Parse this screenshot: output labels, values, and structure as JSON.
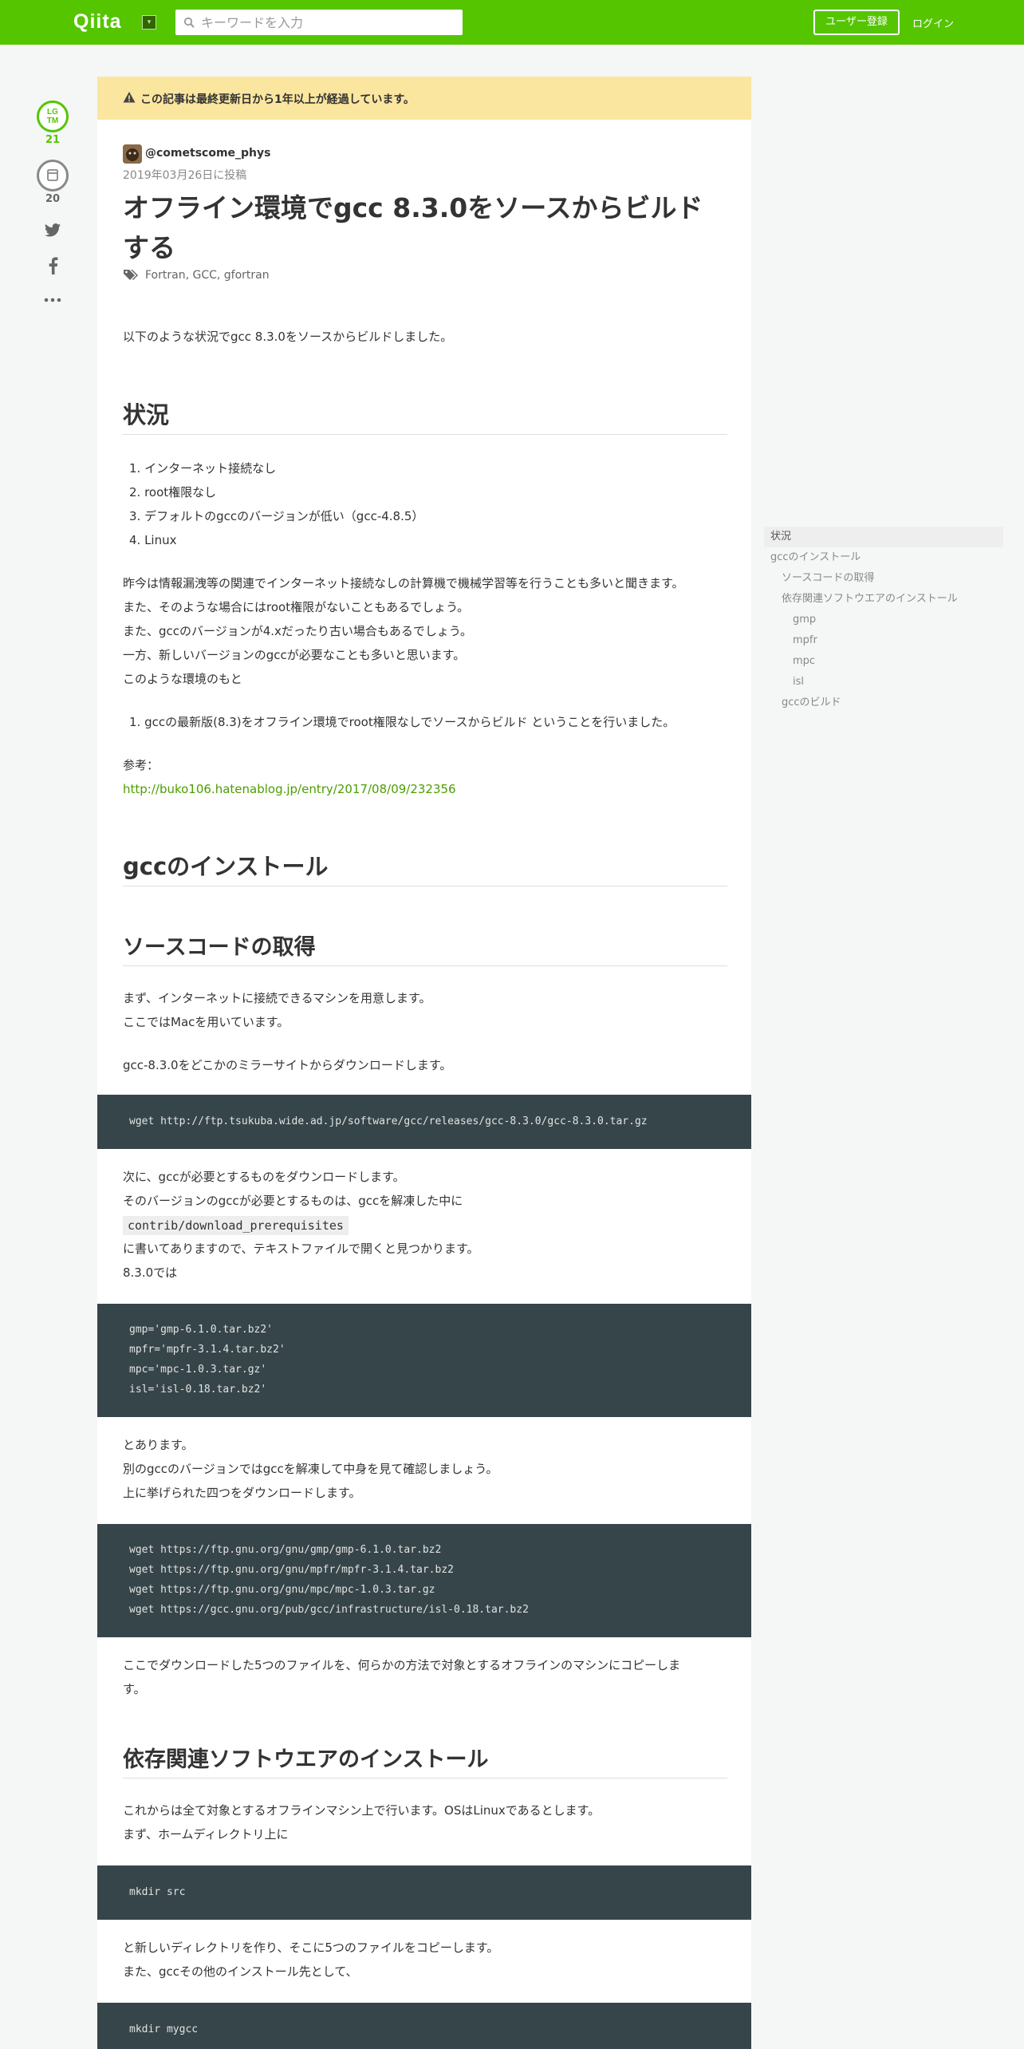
{
  "header": {
    "logo": "Qiita",
    "logo_dropdown": "▾",
    "search_placeholder": "キーワードを入力",
    "signup_label": "ユーザー登録",
    "login_label": "ログイン"
  },
  "side": {
    "lgtm_line1": "LG",
    "lgtm_line2": "TM",
    "lgtm_count": "21",
    "stock_count": "20"
  },
  "article": {
    "notice": "この記事は最終更新日から1年以上が経過しています。",
    "author": "@cometscome_phys",
    "date": "2019年03月26日に投稿",
    "title": "オフライン環境でgcc 8.3.0をソースからビルドする",
    "tags": "Fortran,  GCC,  gfortran",
    "intro": "以下のような状況でgcc 8.3.0をソースからビルドしました。",
    "h_situation": "状況",
    "situation_items": [
      "1. インターネット接続なし",
      "2. root権限なし",
      "3. デフォルトのgccのバージョンが低い（gcc-4.8.5）",
      "4. Linux"
    ],
    "situation_paras": [
      "昨今は情報漏洩等の関連でインターネット接続なしの計算機で機械学習等を行うことも多いと聞きます。",
      "また、そのような場合にはroot権限がないこともあるでしょう。",
      "また、gccのバージョンが4.xだったり古い場合もあるでしょう。",
      "一方、新しいバージョンのgccが必要なことも多いと思います。",
      "このような環境のもと"
    ],
    "goal_item": "1. gccの最新版(8.3)をオフライン環境でroot権限なしでソースからビルド ということを行いました。",
    "ref_label": "参考：",
    "ref_link": "http://buko106.hatenablog.jp/entry/2017/08/09/232356",
    "h_install": "gccのインストール",
    "h_source": "ソースコードの取得",
    "source_paras": [
      "まず、インターネットに接続できるマシンを用意します。",
      "ここではMacを用いています。"
    ],
    "download_para": "gcc-8.3.0をどこかのミラーサイトからダウンロードします。",
    "code1": [
      "wget http://ftp.tsukuba.wide.ad.jp/software/gcc/releases/gcc-8.3.0/gcc-8.3.0.tar.gz"
    ],
    "prereq_paras": [
      "次に、gccが必要とするものをダウンロードします。",
      "そのバージョンのgccが必要とするものは、gccを解凍した中に"
    ],
    "prereq_code": "contrib/download_prerequisites",
    "prereq_paras2": [
      "に書いてありますので、テキストファイルで開くと見つかります。",
      "8.3.0では"
    ],
    "code2": [
      "gmp='gmp-6.1.0.tar.bz2'",
      "mpfr='mpfr-3.1.4.tar.bz2'",
      "mpc='mpc-1.0.3.tar.gz'",
      "isl='isl-0.18.tar.bz2'"
    ],
    "after_code2": [
      "とあります。",
      "別のgccのバージョンではgccを解凍して中身を見て確認しましょう。",
      "上に挙げられた四つをダウンロードします。"
    ],
    "code3": [
      "wget https://ftp.gnu.org/gnu/gmp/gmp-6.1.0.tar.bz2",
      "wget https://ftp.gnu.org/gnu/mpfr/mpfr-3.1.4.tar.bz2",
      "wget https://ftp.gnu.org/gnu/mpc/mpc-1.0.3.tar.gz",
      "wget https://gcc.gnu.org/pub/gcc/infrastructure/isl-0.18.tar.bz2"
    ],
    "copy_para": [
      "ここでダウンロードした5つのファイルを、何らかの方法で対象とするオフラインのマシンにコピーしま",
      "す。"
    ],
    "h_deps": "依存関連ソフトウエアのインストール",
    "deps_paras": [
      "これからは全て対象とするオフラインマシン上で行います。OSはLinuxであるとします。",
      "まず、ホームディレクトリ上に"
    ],
    "code4": [
      "mkdir src"
    ],
    "after_code4": [
      "と新しいディレクトリを作り、そこに5つのファイルをコピーします。",
      "また、gccその他のインストール先として、"
    ],
    "code5": [
      "mkdir mygcc"
    ]
  },
  "toc": [
    "状況",
    "gccのインストール",
    "ソースコードの取得",
    "依存関連ソフトウエアのインストール",
    "gmp",
    "mpfr",
    "mpc",
    "isl",
    "gccのビルド"
  ]
}
